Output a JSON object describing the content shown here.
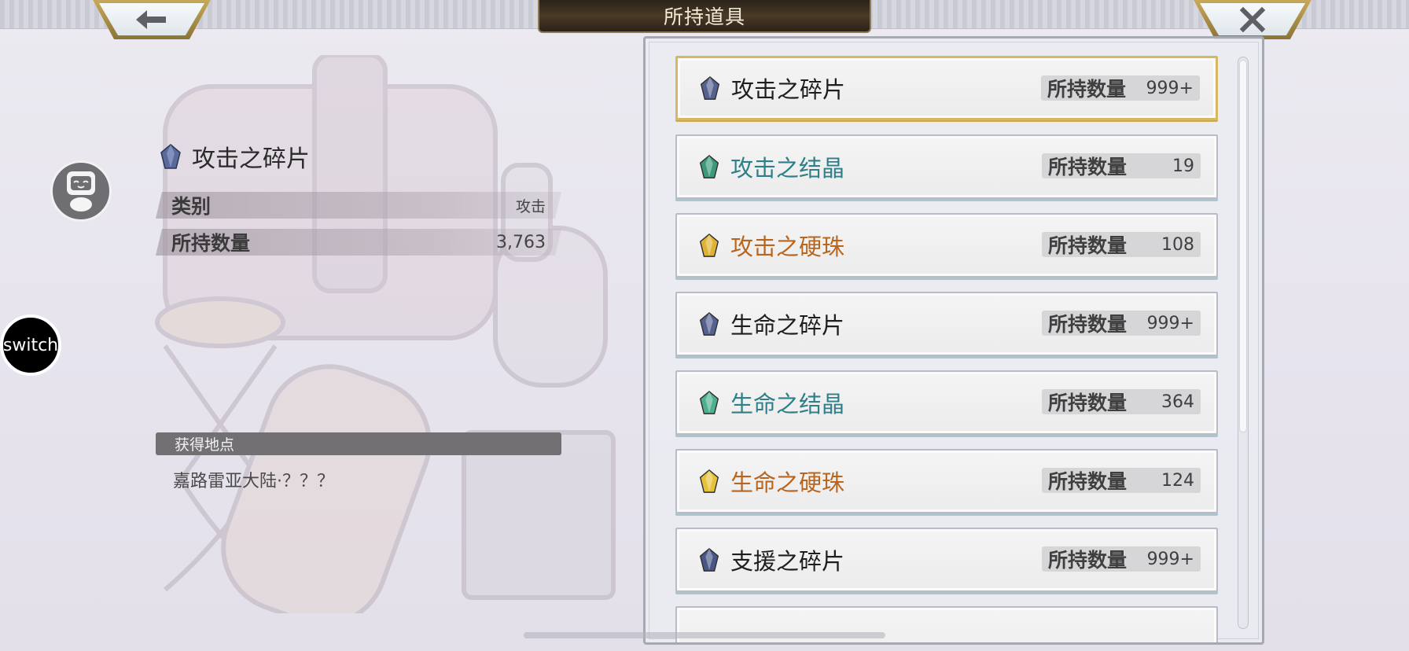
{
  "header": {
    "title": "所持道具",
    "back_icon": "arrow-left-icon",
    "close_icon": "close-icon"
  },
  "side_buttons": {
    "robot_icon": "robot-face-icon",
    "switch_label": "switch"
  },
  "detail": {
    "name": "攻击之碎片",
    "gem_color": "#5a6a9a",
    "category_label": "类别",
    "category_value": "攻击",
    "count_label": "所持数量",
    "count_value": "3,763",
    "source_label": "获得地点",
    "source_value": "嘉路雷亚大陆·？？？"
  },
  "items": [
    {
      "name": "攻击之碎片",
      "qty_label": "所持数量",
      "qty": "999+",
      "color": "dark",
      "gem": "#55628f",
      "selected": true
    },
    {
      "name": "攻击之结晶",
      "qty_label": "所持数量",
      "qty": "19",
      "color": "teal",
      "gem": "#3c9a7a"
    },
    {
      "name": "攻击之硬珠",
      "qty_label": "所持数量",
      "qty": "108",
      "color": "orange",
      "gem": "#e0b232"
    },
    {
      "name": "生命之碎片",
      "qty_label": "所持数量",
      "qty": "999+",
      "color": "dark",
      "gem": "#55628f"
    },
    {
      "name": "生命之结晶",
      "qty_label": "所持数量",
      "qty": "364",
      "color": "teal",
      "gem": "#4fb08e"
    },
    {
      "name": "生命之硬珠",
      "qty_label": "所持数量",
      "qty": "124",
      "color": "orange",
      "gem": "#e6c23a"
    },
    {
      "name": "支援之碎片",
      "qty_label": "所持数量",
      "qty": "999+",
      "color": "dark",
      "gem": "#4a5688"
    },
    {
      "name": "",
      "qty_label": "",
      "qty": "",
      "color": "dark",
      "gem": ""
    }
  ],
  "list": {
    "scroll_fraction": 0.0
  }
}
